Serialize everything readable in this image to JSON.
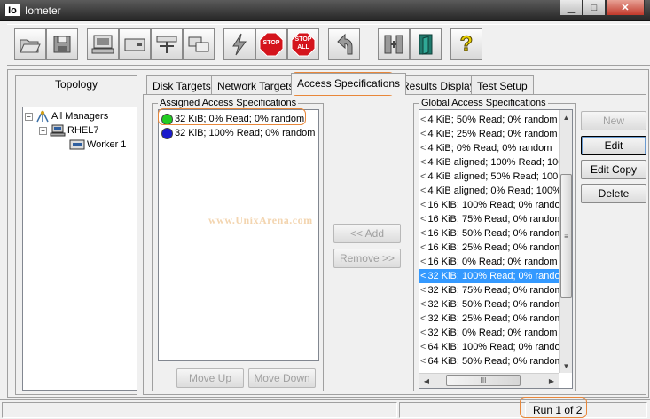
{
  "window": {
    "app_icon": "Io",
    "title": "Iometer",
    "buttons": [
      "minimize-icon",
      "maximize-icon",
      "close-icon"
    ]
  },
  "toolbar": {
    "icons": [
      "open-icon",
      "save-icon",
      "new-manager-icon",
      "new-disk-worker-icon",
      "new-network-worker-icon",
      "copy-worker-icon",
      "start-icon",
      "stop-icon",
      "stop-all-icon",
      "reset-workers-icon",
      "exit-all-icon",
      "exit-icon",
      "help-icon"
    ],
    "stop_label": "STOP",
    "stop_all_label": "STOP",
    "stop_all_sub": "ALL",
    "help_label": "?"
  },
  "topology": {
    "title": "Topology",
    "root": "All Managers",
    "manager": "RHEL7",
    "worker": "Worker 1"
  },
  "tabs": [
    "Disk Targets",
    "Network Targets",
    "Access Specifications",
    "Results Display",
    "Test Setup"
  ],
  "active_tab": "Access Specifications",
  "assigned": {
    "legend": "Assigned Access Specifications",
    "items": [
      {
        "label": "32 KiB; 0% Read; 0% random",
        "color": "#22cc22"
      },
      {
        "label": "32 KiB; 100% Read; 0% random",
        "color": "#1a1acc"
      }
    ],
    "move_up": "Move Up",
    "move_down": "Move Down"
  },
  "middle": {
    "add": "<< Add",
    "remove": "Remove >>"
  },
  "global": {
    "legend": "Global Access Specifications",
    "items": [
      "4 KiB; 50% Read; 0% random",
      "4 KiB; 25% Read; 0% random",
      "4 KiB; 0% Read; 0% random",
      "4 KiB aligned; 100% Read; 100...",
      "4 KiB aligned; 50% Read; 100...",
      "4 KiB aligned; 0% Read; 100% ...",
      "16 KiB; 100% Read; 0% random",
      "16 KiB; 75% Read; 0% random",
      "16 KiB; 50% Read; 0% random",
      "16 KiB; 25% Read; 0% random",
      "16 KiB; 0% Read; 0% random",
      "32 KiB; 100% Read; 0% random",
      "32 KiB; 75% Read; 0% random",
      "32 KiB; 50% Read; 0% random",
      "32 KiB; 25% Read; 0% random",
      "32 KiB; 0% Read; 0% random",
      "64 KiB; 100% Read; 0% random",
      "64 KiB; 50% Read; 0% random"
    ],
    "selected": "32 KiB; 100% Read; 0% random",
    "buttons": {
      "new": "New",
      "edit": "Edit",
      "edit_copy": "Edit Copy",
      "delete": "Delete"
    },
    "scroll_grip": "≡",
    "hscroll_grip": "III"
  },
  "watermark": "www.UnixArena.com",
  "status": {
    "run": "Run 1 of 2"
  },
  "colors": {
    "selection": "#3399ff",
    "annotation": "#e8873a",
    "stop_red": "#d4141c"
  }
}
